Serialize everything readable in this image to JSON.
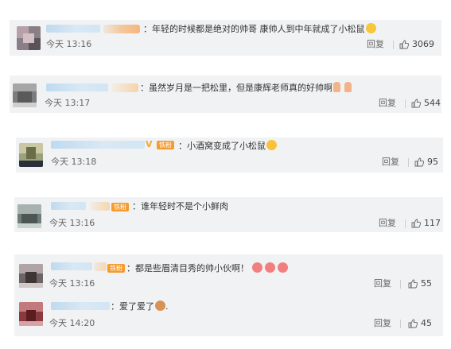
{
  "comments": [
    {
      "text": "年轻的时候都是绝对的帅哥 康帅人到中年就成了小松鼠",
      "time": "今天 13:16",
      "reply": "回复",
      "likes": "3069",
      "emoji": "smile-emoji"
    },
    {
      "text": "虽然岁月是一把松里，但是康辉老师真的好帅啊",
      "time": "今天 13:17",
      "reply": "回复",
      "likes": "544",
      "emoji": "clap-emoji"
    },
    {
      "text": "小酒窝变成了小松鼠",
      "time": "今天 13:18",
      "reply": "回复",
      "likes": "95",
      "badge": "铁粉",
      "emoji": "laugh-emoji"
    },
    {
      "text": "谁年轻时不是个小鲜肉",
      "time": "今天 13:16",
      "reply": "回复",
      "likes": "117",
      "badge": "铁粉"
    },
    {
      "text": "都是些眉清目秀的帅小伙啊！",
      "time": "今天 13:16",
      "reply": "回复",
      "likes": "55",
      "badge": "铁粉",
      "emoji": "love-emoji"
    },
    {
      "text": "爱了爱了",
      "time": "今天 14:20",
      "reply": "回复",
      "likes": "45",
      "emoji": "cat-emoji"
    }
  ],
  "colors": {
    "card_bg": "#f1f2f4",
    "badge": "#f49b2f",
    "username": "#b9d7ee"
  }
}
